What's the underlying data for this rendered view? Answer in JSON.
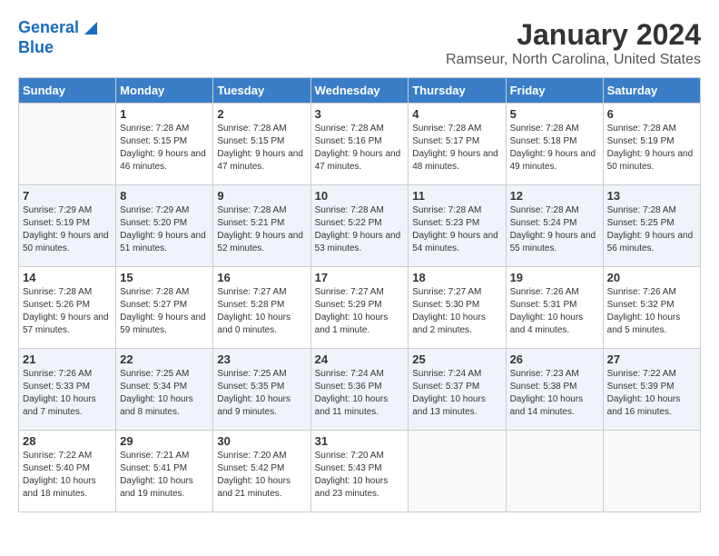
{
  "header": {
    "logo_line1": "General",
    "logo_line2": "Blue",
    "title": "January 2024",
    "subtitle": "Ramseur, North Carolina, United States"
  },
  "calendar": {
    "days_of_week": [
      "Sunday",
      "Monday",
      "Tuesday",
      "Wednesday",
      "Thursday",
      "Friday",
      "Saturday"
    ],
    "weeks": [
      [
        {
          "day": "",
          "sunrise": "",
          "sunset": "",
          "daylight": ""
        },
        {
          "day": "1",
          "sunrise": "Sunrise: 7:28 AM",
          "sunset": "Sunset: 5:15 PM",
          "daylight": "Daylight: 9 hours and 46 minutes."
        },
        {
          "day": "2",
          "sunrise": "Sunrise: 7:28 AM",
          "sunset": "Sunset: 5:15 PM",
          "daylight": "Daylight: 9 hours and 47 minutes."
        },
        {
          "day": "3",
          "sunrise": "Sunrise: 7:28 AM",
          "sunset": "Sunset: 5:16 PM",
          "daylight": "Daylight: 9 hours and 47 minutes."
        },
        {
          "day": "4",
          "sunrise": "Sunrise: 7:28 AM",
          "sunset": "Sunset: 5:17 PM",
          "daylight": "Daylight: 9 hours and 48 minutes."
        },
        {
          "day": "5",
          "sunrise": "Sunrise: 7:28 AM",
          "sunset": "Sunset: 5:18 PM",
          "daylight": "Daylight: 9 hours and 49 minutes."
        },
        {
          "day": "6",
          "sunrise": "Sunrise: 7:28 AM",
          "sunset": "Sunset: 5:19 PM",
          "daylight": "Daylight: 9 hours and 50 minutes."
        }
      ],
      [
        {
          "day": "7",
          "sunrise": "Sunrise: 7:29 AM",
          "sunset": "Sunset: 5:19 PM",
          "daylight": "Daylight: 9 hours and 50 minutes."
        },
        {
          "day": "8",
          "sunrise": "Sunrise: 7:29 AM",
          "sunset": "Sunset: 5:20 PM",
          "daylight": "Daylight: 9 hours and 51 minutes."
        },
        {
          "day": "9",
          "sunrise": "Sunrise: 7:28 AM",
          "sunset": "Sunset: 5:21 PM",
          "daylight": "Daylight: 9 hours and 52 minutes."
        },
        {
          "day": "10",
          "sunrise": "Sunrise: 7:28 AM",
          "sunset": "Sunset: 5:22 PM",
          "daylight": "Daylight: 9 hours and 53 minutes."
        },
        {
          "day": "11",
          "sunrise": "Sunrise: 7:28 AM",
          "sunset": "Sunset: 5:23 PM",
          "daylight": "Daylight: 9 hours and 54 minutes."
        },
        {
          "day": "12",
          "sunrise": "Sunrise: 7:28 AM",
          "sunset": "Sunset: 5:24 PM",
          "daylight": "Daylight: 9 hours and 55 minutes."
        },
        {
          "day": "13",
          "sunrise": "Sunrise: 7:28 AM",
          "sunset": "Sunset: 5:25 PM",
          "daylight": "Daylight: 9 hours and 56 minutes."
        }
      ],
      [
        {
          "day": "14",
          "sunrise": "Sunrise: 7:28 AM",
          "sunset": "Sunset: 5:26 PM",
          "daylight": "Daylight: 9 hours and 57 minutes."
        },
        {
          "day": "15",
          "sunrise": "Sunrise: 7:28 AM",
          "sunset": "Sunset: 5:27 PM",
          "daylight": "Daylight: 9 hours and 59 minutes."
        },
        {
          "day": "16",
          "sunrise": "Sunrise: 7:27 AM",
          "sunset": "Sunset: 5:28 PM",
          "daylight": "Daylight: 10 hours and 0 minutes."
        },
        {
          "day": "17",
          "sunrise": "Sunrise: 7:27 AM",
          "sunset": "Sunset: 5:29 PM",
          "daylight": "Daylight: 10 hours and 1 minute."
        },
        {
          "day": "18",
          "sunrise": "Sunrise: 7:27 AM",
          "sunset": "Sunset: 5:30 PM",
          "daylight": "Daylight: 10 hours and 2 minutes."
        },
        {
          "day": "19",
          "sunrise": "Sunrise: 7:26 AM",
          "sunset": "Sunset: 5:31 PM",
          "daylight": "Daylight: 10 hours and 4 minutes."
        },
        {
          "day": "20",
          "sunrise": "Sunrise: 7:26 AM",
          "sunset": "Sunset: 5:32 PM",
          "daylight": "Daylight: 10 hours and 5 minutes."
        }
      ],
      [
        {
          "day": "21",
          "sunrise": "Sunrise: 7:26 AM",
          "sunset": "Sunset: 5:33 PM",
          "daylight": "Daylight: 10 hours and 7 minutes."
        },
        {
          "day": "22",
          "sunrise": "Sunrise: 7:25 AM",
          "sunset": "Sunset: 5:34 PM",
          "daylight": "Daylight: 10 hours and 8 minutes."
        },
        {
          "day": "23",
          "sunrise": "Sunrise: 7:25 AM",
          "sunset": "Sunset: 5:35 PM",
          "daylight": "Daylight: 10 hours and 9 minutes."
        },
        {
          "day": "24",
          "sunrise": "Sunrise: 7:24 AM",
          "sunset": "Sunset: 5:36 PM",
          "daylight": "Daylight: 10 hours and 11 minutes."
        },
        {
          "day": "25",
          "sunrise": "Sunrise: 7:24 AM",
          "sunset": "Sunset: 5:37 PM",
          "daylight": "Daylight: 10 hours and 13 minutes."
        },
        {
          "day": "26",
          "sunrise": "Sunrise: 7:23 AM",
          "sunset": "Sunset: 5:38 PM",
          "daylight": "Daylight: 10 hours and 14 minutes."
        },
        {
          "day": "27",
          "sunrise": "Sunrise: 7:22 AM",
          "sunset": "Sunset: 5:39 PM",
          "daylight": "Daylight: 10 hours and 16 minutes."
        }
      ],
      [
        {
          "day": "28",
          "sunrise": "Sunrise: 7:22 AM",
          "sunset": "Sunset: 5:40 PM",
          "daylight": "Daylight: 10 hours and 18 minutes."
        },
        {
          "day": "29",
          "sunrise": "Sunrise: 7:21 AM",
          "sunset": "Sunset: 5:41 PM",
          "daylight": "Daylight: 10 hours and 19 minutes."
        },
        {
          "day": "30",
          "sunrise": "Sunrise: 7:20 AM",
          "sunset": "Sunset: 5:42 PM",
          "daylight": "Daylight: 10 hours and 21 minutes."
        },
        {
          "day": "31",
          "sunrise": "Sunrise: 7:20 AM",
          "sunset": "Sunset: 5:43 PM",
          "daylight": "Daylight: 10 hours and 23 minutes."
        },
        {
          "day": "",
          "sunrise": "",
          "sunset": "",
          "daylight": ""
        },
        {
          "day": "",
          "sunrise": "",
          "sunset": "",
          "daylight": ""
        },
        {
          "day": "",
          "sunrise": "",
          "sunset": "",
          "daylight": ""
        }
      ]
    ]
  }
}
